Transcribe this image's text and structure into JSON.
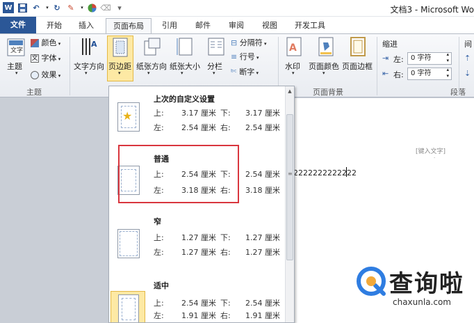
{
  "window": {
    "title": "文档3 - Microsoft Wo"
  },
  "tabs": {
    "file": "文件",
    "home": "开始",
    "insert": "插入",
    "page_layout": "页面布局",
    "references": "引用",
    "mailings": "邮件",
    "review": "审阅",
    "view": "视图",
    "developer": "开发工具"
  },
  "ribbon": {
    "theme_group": {
      "themes": "主题",
      "colors": "颜色",
      "fonts": "字体",
      "effects": "效果",
      "label": "主题"
    },
    "page_setup": {
      "text_direction": "文字方向",
      "margins": "页边距",
      "orientation": "纸张方向",
      "size": "纸张大小",
      "columns": "分栏",
      "breaks": "分隔符",
      "line_numbers": "行号",
      "hyphenation": "断字"
    },
    "page_background": {
      "watermark": "水印",
      "page_color": "页面颜色",
      "page_borders": "页面边框",
      "label": "页面背景"
    },
    "paragraph": {
      "indent": "缩进",
      "left_label": "左:",
      "left_value": "0 字符",
      "right_label": "右:",
      "right_value": "0 字符",
      "label": "段落",
      "spacing": "间"
    }
  },
  "margins_gallery": {
    "options": [
      {
        "name": "上次的自定义设置",
        "top_label": "上:",
        "top": "3.17 厘米",
        "bottom_label": "下:",
        "bottom": "3.17 厘米",
        "left_label": "左:",
        "left": "2.54 厘米",
        "right_label": "右:",
        "right": "2.54 厘米"
      },
      {
        "name": "普通",
        "top_label": "上:",
        "top": "2.54 厘米",
        "bottom_label": "下:",
        "bottom": "2.54 厘米",
        "left_label": "左:",
        "left": "3.18 厘米",
        "right_label": "右:",
        "right": "3.18 厘米"
      },
      {
        "name": "窄",
        "top_label": "上:",
        "top": "1.27 厘米",
        "bottom_label": "下:",
        "bottom": "1.27 厘米",
        "left_label": "左:",
        "left": "1.27 厘米",
        "right_label": "右:",
        "right": "1.27 厘米"
      },
      {
        "name": "适中",
        "top_label": "上:",
        "top": "2.54 厘米",
        "bottom_label": "下:",
        "bottom": "2.54 厘米",
        "left_label": "左:",
        "left": "1.91 厘米",
        "right_label": "右:",
        "right": "1.91 厘米"
      }
    ]
  },
  "document": {
    "header_placeholder": "[键入文字]",
    "body_text": "2222222222222"
  },
  "watermark": {
    "text": "查询啦",
    "url": "chaxunla.com"
  },
  "colors": {
    "file_tab": "#2b5797",
    "highlight_box": "#d9363e",
    "selected_button": "#fde9a4",
    "watermark_blue": "#2f7de1"
  }
}
